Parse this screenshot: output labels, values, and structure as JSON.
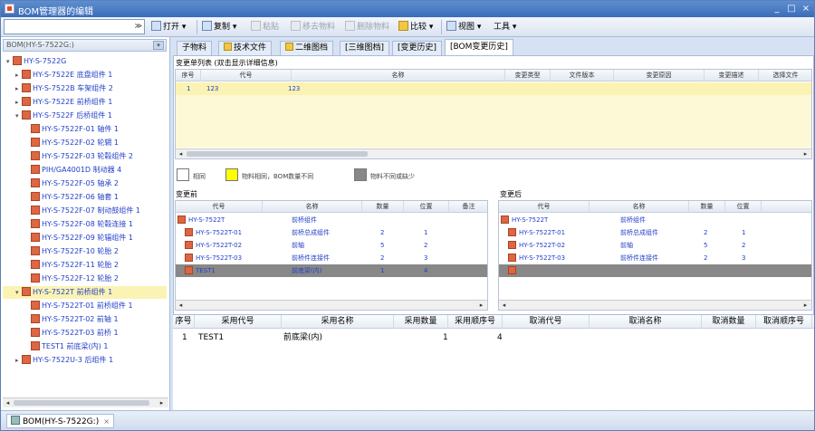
{
  "titlebar": {
    "title": "BOM管理器的编辑",
    "min": "_",
    "max": "□",
    "close": "×"
  },
  "toolbar": {
    "combo_value": "",
    "open": "打开 ▾",
    "copy": "复制 ▾",
    "paste": "粘贴",
    "move": "移去物料",
    "delete": "删除物料",
    "compare": "比较 ▾",
    "view": "视图 ▾",
    "tools": "工具 ▾"
  },
  "left_panel": {
    "header": "BOM(HY-S-7522G:)",
    "tree": [
      {
        "text": "HY-S-7522G",
        "level": 0,
        "exp": "▾"
      },
      {
        "text": "HY-S-7522E 底盘组件 1",
        "level": 1,
        "exp": "▸"
      },
      {
        "text": "HY-S-7522B 车架组件 2",
        "level": 1,
        "exp": "▸"
      },
      {
        "text": "HY-S-7522E 前桥组件 1",
        "level": 1,
        "exp": "▸"
      },
      {
        "text": "HY-S-7522F 后桥组件 1",
        "level": 1,
        "exp": "▾"
      },
      {
        "text": "HY-S-7522F-01 轴件 1",
        "level": 2,
        "exp": ""
      },
      {
        "text": "HY-S-7522F-02 轮辋 1",
        "level": 2,
        "exp": ""
      },
      {
        "text": "HY-S-7522F-03 轮毂组件 2",
        "level": 2,
        "exp": ""
      },
      {
        "text": "PIH/GA4001D 制动器 4",
        "level": 2,
        "exp": ""
      },
      {
        "text": "HY-S-7522F-05 轴承 2",
        "level": 2,
        "exp": ""
      },
      {
        "text": "HY-S-7522F-06 轴套 1",
        "level": 2,
        "exp": ""
      },
      {
        "text": "HY-S-7522F-07 制动鼓组件 1",
        "level": 2,
        "exp": ""
      },
      {
        "text": "HY-S-7522F-08 轮毂连接 1",
        "level": 2,
        "exp": ""
      },
      {
        "text": "HY-S-7522F-09 轮辐组件 1",
        "level": 2,
        "exp": ""
      },
      {
        "text": "HY-S-7522F-10 轮胎 2",
        "level": 2,
        "exp": ""
      },
      {
        "text": "HY-S-7522F-11 轮胎 2",
        "level": 2,
        "exp": ""
      },
      {
        "text": "HY-S-7522F-12 轮胎 2",
        "level": 2,
        "exp": ""
      },
      {
        "text": "HY-S-7522T 前桥组件 1",
        "level": 1,
        "exp": "▾",
        "selected": true
      },
      {
        "text": "HY-S-7522T-01 前桥组件 1",
        "level": 2,
        "exp": ""
      },
      {
        "text": "HY-S-7522T-02 前轴 1",
        "level": 2,
        "exp": ""
      },
      {
        "text": "HY-S-7522T-03 前桥 1",
        "level": 2,
        "exp": ""
      },
      {
        "text": "TEST1 前底梁(内) 1",
        "level": 2,
        "exp": ""
      },
      {
        "text": "HY-S-7522U-3 后组件 1",
        "level": 1,
        "exp": "▸"
      }
    ]
  },
  "tabs": [
    {
      "label": "子物料"
    },
    {
      "label": "技术文件"
    },
    {
      "label": "二维图档"
    },
    {
      "label": "[三维图档]"
    },
    {
      "label": "[变更历史]"
    },
    {
      "label": "[BOM变更历史]",
      "active": true
    }
  ],
  "change_list": {
    "title": "变更单列表 (双击显示详细信息)",
    "columns": [
      "序号",
      "代号",
      "名称",
      "变更类型",
      "文件版本",
      "变更原因",
      "变更描述",
      "选择文件"
    ],
    "rows": [
      [
        "1",
        "123",
        "123",
        "",
        "",
        "",
        "",
        ""
      ]
    ]
  },
  "legend": [
    {
      "label": "相同",
      "color": "#ffffff"
    },
    {
      "label": "物料相同，BOM数量不同",
      "color": "#ffff00"
    },
    {
      "label": "物料不同或缺少",
      "color": "#888888"
    }
  ],
  "before": {
    "title": "变更前",
    "columns": [
      "代号",
      "名称",
      "数量",
      "位置",
      "备注"
    ],
    "rows": [
      [
        "HY-S-7522T",
        "前桥组件",
        "",
        "",
        ""
      ],
      [
        "HY-S-7522T-01",
        "前桥总成组件",
        "2",
        "1",
        ""
      ],
      [
        "HY-S-7522T-02",
        "前轴",
        "5",
        "2",
        ""
      ],
      [
        "HY-S-7522T-03",
        "前桥件连接件",
        "2",
        "3",
        ""
      ],
      [
        "TEST1",
        "前底梁(内)",
        "1",
        "4",
        ""
      ]
    ]
  },
  "after": {
    "title": "变更后",
    "columns": [
      "代号",
      "名称",
      "数量",
      "位置"
    ],
    "rows": [
      [
        "HY-S-7522T",
        "前桥组件",
        "",
        ""
      ],
      [
        "HY-S-7522T-01",
        "前桥总成组件",
        "2",
        "1"
      ],
      [
        "HY-S-7522T-02",
        "前轴",
        "5",
        "2"
      ],
      [
        "HY-S-7522T-03",
        "前桥件连接件",
        "2",
        "3"
      ],
      [
        "",
        "",
        "",
        ""
      ]
    ]
  },
  "replacement": {
    "columns": [
      "序号",
      "采用代号",
      "采用名称",
      "采用数量",
      "采用顺序号",
      "取消代号",
      "取消名称",
      "取消数量",
      "取消顺序号"
    ],
    "rows": [
      [
        "1",
        "TEST1",
        "前底梁(内)",
        "1",
        "4",
        "",
        "",
        "",
        ""
      ]
    ]
  },
  "statusbar": {
    "doc_tab": "BOM(HY-S-7522G:)",
    "close": "×"
  }
}
